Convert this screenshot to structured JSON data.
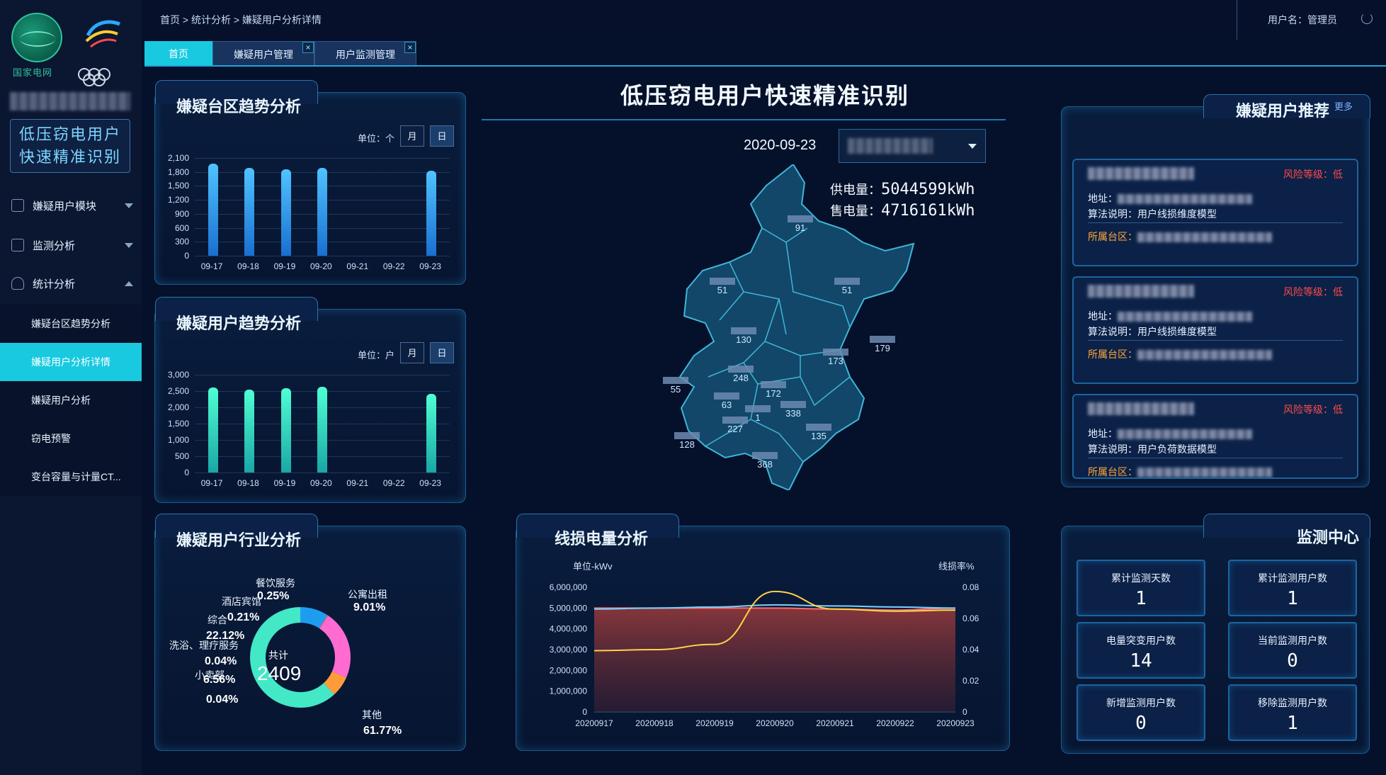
{
  "sidebar": {
    "logo_text": "国家电网",
    "system_title_line1": "低压窃电用户",
    "system_title_line2": "快速精准识别",
    "menu": [
      {
        "label": "嫌疑用户模块"
      },
      {
        "label": "监测分析"
      },
      {
        "label": "统计分析"
      }
    ],
    "submenu": [
      {
        "label": "嫌疑台区趋势分析"
      },
      {
        "label": "嫌疑用户分析详情"
      },
      {
        "label": "嫌疑用户分析"
      },
      {
        "label": "窃电预警"
      },
      {
        "label": "变台容量与计量CT..."
      }
    ]
  },
  "topbar": {
    "breadcrumb": "首页 > 统计分析 > 嫌疑用户分析详情",
    "username": "用户名：管理员"
  },
  "tabs": [
    {
      "label": "首页"
    },
    {
      "label": "嫌疑用户管理"
    },
    {
      "label": "用户监测管理"
    }
  ],
  "center": {
    "title": "低压窃电用户快速精准识别",
    "date": "2020-09-23",
    "supply_label": "供电量：",
    "supply_value": "5044599kWh",
    "sales_label": "售电量：",
    "sales_value": "4716161kWh",
    "map_values": [
      "91",
      "51",
      "51",
      "130",
      "173",
      "179",
      "55",
      "248",
      "172",
      "63",
      "338",
      "1",
      "227",
      "135",
      "128",
      "368"
    ]
  },
  "panel_area_trend": {
    "title": "嫌疑台区趋势分析",
    "unit": "单位：个",
    "seg_month": "月",
    "seg_day": "日",
    "chart_data": {
      "type": "bar",
      "categories": [
        "09-17",
        "09-18",
        "09-19",
        "09-20",
        "09-21",
        "09-22",
        "09-23"
      ],
      "values": [
        1980,
        1880,
        1850,
        1880,
        0,
        0,
        1820
      ],
      "yticks": [
        "2,100",
        "1,800",
        "1,500",
        "1,200",
        "900",
        "600",
        "300",
        "0"
      ],
      "ylim": [
        0,
        2100
      ],
      "color_top": "#4fc3ff",
      "color_bottom": "#1a6fd0"
    }
  },
  "panel_user_trend": {
    "title": "嫌疑用户趋势分析",
    "unit": "单位：户",
    "seg_month": "月",
    "seg_day": "日",
    "chart_data": {
      "type": "bar",
      "categories": [
        "09-17",
        "09-18",
        "09-19",
        "09-20",
        "09-21",
        "09-22",
        "09-23"
      ],
      "values": [
        2600,
        2550,
        2580,
        2620,
        0,
        0,
        2420
      ],
      "yticks": [
        "3,000",
        "2,500",
        "2,000",
        "1,500",
        "1,000",
        "500",
        "0"
      ],
      "ylim": [
        0,
        3000
      ],
      "color_top": "#4fffd3",
      "color_bottom": "#1aa7a6"
    }
  },
  "panel_industry": {
    "title": "嫌疑用户行业分析",
    "total_label": "共计",
    "total_value": "2409",
    "chart_data": {
      "type": "pie",
      "labels": [
        "公寓出租",
        "餐饮服务",
        "酒店宾馆",
        "综合",
        "洗浴、理疗服务",
        "小卖部",
        "",
        "",
        "其他"
      ],
      "values_text": [
        "9.01%",
        "0.25%",
        "0.21%",
        "22.12%",
        "0.04%",
        "6.56%",
        "",
        "0.04%",
        "61.77%"
      ],
      "values": [
        9.01,
        0.25,
        0.21,
        22.12,
        0.04,
        6.56,
        0,
        0.04,
        61.77
      ],
      "colors": [
        "#1e9df0",
        "#9b6cf0",
        "#ff8a2b",
        "#ff6bd1",
        "#f0f0f0",
        "#ff9c3a",
        "#ffffff",
        "#ffffff",
        "#43e8c6"
      ]
    }
  },
  "panel_lineloss": {
    "title": "线损电量分析",
    "unit_left": "单位-kWv",
    "unit_right": "线损率%",
    "chart_data": {
      "type": "line",
      "x": [
        "20200917",
        "20200918",
        "20200919",
        "20200920",
        "20200921",
        "20200922",
        "20200923"
      ],
      "y_left_ticks": [
        "6,000,000",
        "5,000,000",
        "4,000,000",
        "3,000,000",
        "2,000,000",
        "1,000,000",
        "0"
      ],
      "y_right_ticks": [
        "0.08",
        "0.06",
        "0.04",
        "0.02",
        "0"
      ],
      "ylim_left": [
        0,
        6000000
      ],
      "ylim_right": [
        0,
        0.08
      ],
      "series": [
        {
          "values": [
            5000000,
            5000000,
            5000000,
            5000000,
            4950000,
            4900000,
            5000000
          ],
          "color": "#ff6b6b"
        },
        {
          "values": [
            4950000,
            5000000,
            5050000,
            5150000,
            5100000,
            5050000,
            5000000
          ],
          "color": "#79d2ff"
        },
        {
          "values": [
            2950000,
            3000000,
            3250000,
            5800000,
            4950000,
            4850000,
            4900000
          ],
          "color": "#ffd24a"
        }
      ]
    }
  },
  "panel_suspects": {
    "title": "嫌疑用户推荐",
    "more": "更多",
    "items": [
      {
        "risk": "风险等级：低",
        "addr_label": "地址：",
        "algo": "算法说明：用户线损维度模型",
        "zone_label": "所属台区："
      },
      {
        "risk": "风险等级：低",
        "addr_label": "地址：",
        "algo": "算法说明：用户线损维度模型",
        "zone_label": "所属台区："
      },
      {
        "risk": "风险等级：低",
        "addr_label": "地址：",
        "algo": "算法说明：用户负荷数据模型",
        "zone_label": "所属台区："
      }
    ]
  },
  "panel_monitor": {
    "title": "监测中心",
    "items": [
      {
        "label": "累计监测天数",
        "value": "1"
      },
      {
        "label": "累计监测用户数",
        "value": "1"
      },
      {
        "label": "电量突变用户数",
        "value": "14"
      },
      {
        "label": "当前监测用户数",
        "value": "0"
      },
      {
        "label": "新增监测用户数",
        "value": "0"
      },
      {
        "label": "移除监测用户数",
        "value": "1"
      }
    ]
  }
}
